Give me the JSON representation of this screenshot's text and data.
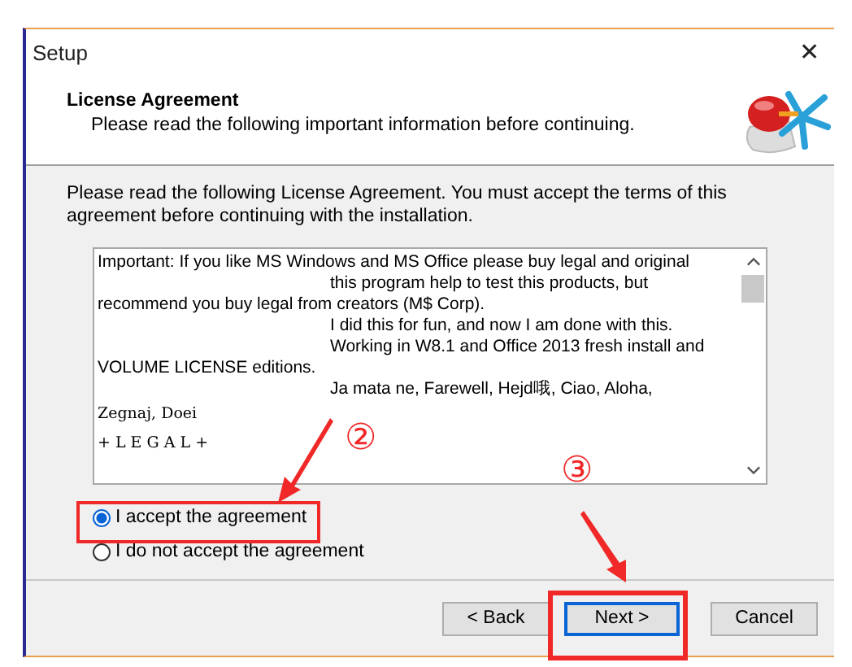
{
  "window": {
    "title": "Setup",
    "close": "✕"
  },
  "header": {
    "title": "License Agreement",
    "subtitle": "Please read the following important information before continuing."
  },
  "intro": "Please read the following License Agreement. You must accept the terms of this agreement before continuing with the installation.",
  "license_text": [
    {
      "text": "Important: If you like MS Windows and MS Office please buy legal and original",
      "indent": false,
      "kind": "normal"
    },
    {
      "text": "this program help to test this products, but",
      "indent": true,
      "kind": "normal"
    },
    {
      "text": "recommend you buy legal from creators (M$ Corp).",
      "indent": false,
      "kind": "normal"
    },
    {
      "text": "I did this for fun, and now I am done with this.",
      "indent": true,
      "kind": "normal"
    },
    {
      "text": "Working in W8.1 and Office 2013 fresh install and",
      "indent": true,
      "kind": "normal"
    },
    {
      "text": "VOLUME LICENSE editions.",
      "indent": false,
      "kind": "normal"
    },
    {
      "text": "Ja mata ne, Farewell, Hejd哦, Ciao, Aloha,",
      "indent": true,
      "kind": "normal"
    },
    {
      "text": "Zegnaj, Doei",
      "indent": false,
      "kind": "mono"
    },
    {
      "text": "+ L E G A L +",
      "indent": false,
      "kind": "mono"
    }
  ],
  "options": [
    {
      "label": "I accept the agreement",
      "selected": true
    },
    {
      "label": "I do not accept the agreement",
      "selected": false
    }
  ],
  "buttons": [
    {
      "label": "< Back",
      "default": false
    },
    {
      "label": "Next >",
      "default": true
    },
    {
      "label": "Cancel",
      "default": false
    }
  ],
  "annotations": [
    {
      "label": "②"
    },
    {
      "label": "③"
    }
  ]
}
